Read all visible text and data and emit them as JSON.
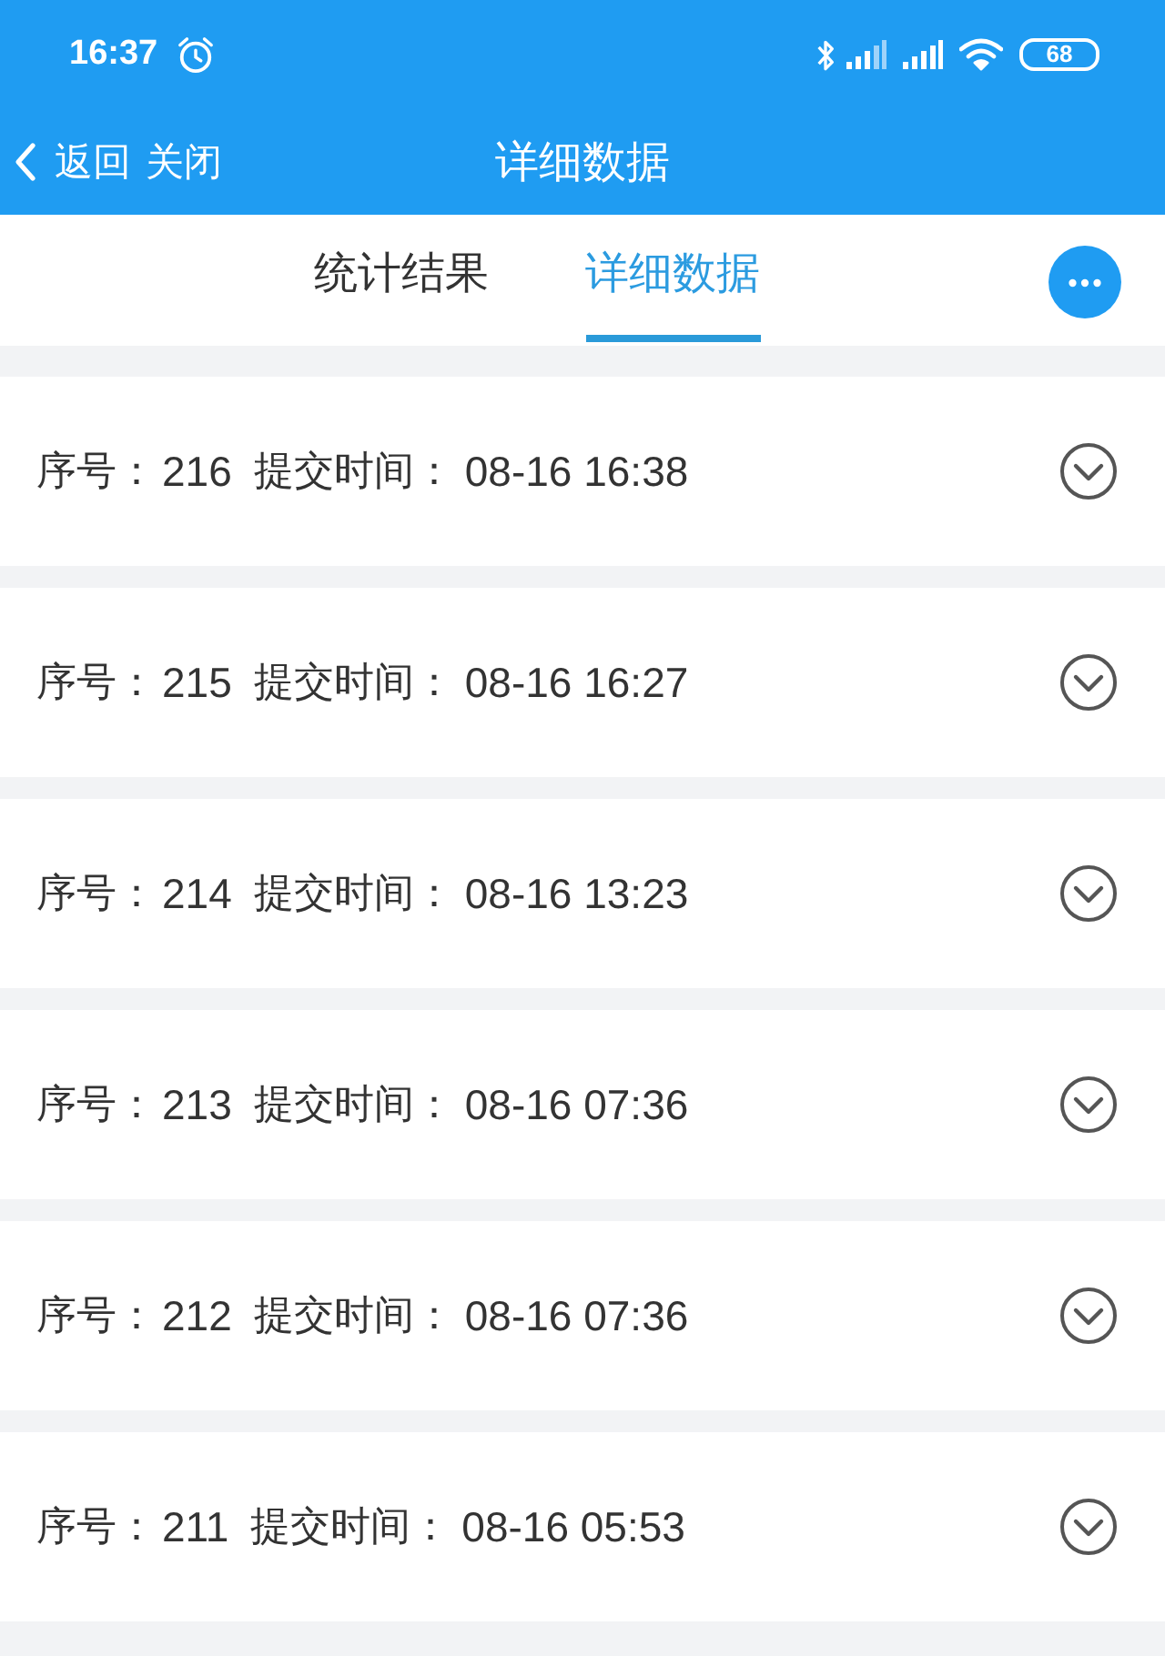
{
  "status_bar": {
    "time": "16:37",
    "battery": "68"
  },
  "nav_bar": {
    "back": "返回",
    "close": "关闭",
    "title": "详细数据"
  },
  "tabs": [
    {
      "label": "统计结果",
      "selected": false
    },
    {
      "label": "详细数据",
      "selected": true
    }
  ],
  "records": [
    {
      "serial_label": "序号：",
      "serial": "216",
      "time_label": "提交时间：",
      "time": "08-16 16:38",
      "expanded": false
    },
    {
      "serial_label": "序号：",
      "serial": "215",
      "time_label": "提交时间：",
      "time": "08-16 16:27",
      "expanded": false
    },
    {
      "serial_label": "序号：",
      "serial": "214",
      "time_label": "提交时间：",
      "time": "08-16 13:23",
      "expanded": false
    },
    {
      "serial_label": "序号：",
      "serial": "213",
      "time_label": "提交时间：",
      "time": "08-16 07:36",
      "expanded": false
    },
    {
      "serial_label": "序号：",
      "serial": "212",
      "time_label": "提交时间：",
      "time": "08-16 07:36",
      "expanded": false
    },
    {
      "serial_label": "序号：",
      "serial": "211",
      "time_label": "提交时间：",
      "time": "08-16 05:53",
      "expanded": false
    }
  ]
}
